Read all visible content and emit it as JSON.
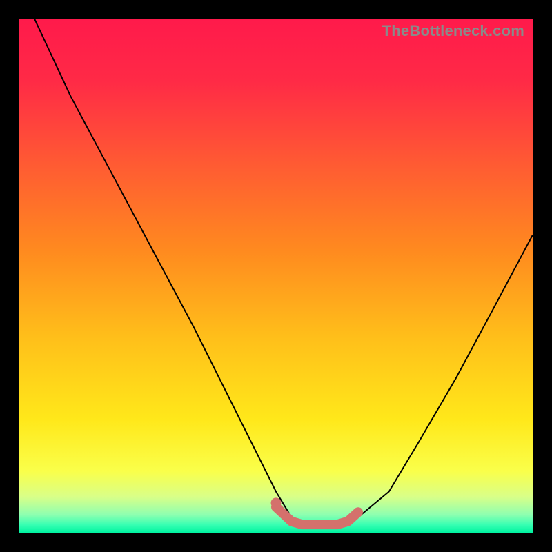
{
  "watermark": "TheBottleneck.com",
  "gradient_stops": [
    {
      "offset": 0.0,
      "color": "#ff1a4b"
    },
    {
      "offset": 0.12,
      "color": "#ff2a46"
    },
    {
      "offset": 0.28,
      "color": "#ff5a33"
    },
    {
      "offset": 0.45,
      "color": "#ff8a1f"
    },
    {
      "offset": 0.62,
      "color": "#ffbf1a"
    },
    {
      "offset": 0.78,
      "color": "#ffe81a"
    },
    {
      "offset": 0.88,
      "color": "#faff4a"
    },
    {
      "offset": 0.93,
      "color": "#d9ff88"
    },
    {
      "offset": 0.965,
      "color": "#8effb0"
    },
    {
      "offset": 0.985,
      "color": "#36ffb2"
    },
    {
      "offset": 1.0,
      "color": "#00f3a0"
    }
  ],
  "chart_data": {
    "type": "line",
    "title": "",
    "xlabel": "",
    "ylabel": "",
    "xlim": [
      0,
      100
    ],
    "ylim": [
      0,
      100
    ],
    "grid": false,
    "legend": false,
    "series": [
      {
        "name": "bottleneck-curve",
        "color": "#000000",
        "stroke_width": 2,
        "x": [
          3,
          10,
          18,
          26,
          34,
          40,
          46,
          50,
          53,
          55,
          58,
          62,
          66,
          72,
          78,
          85,
          92,
          100
        ],
        "values": [
          100,
          85,
          70,
          55,
          40,
          28,
          16,
          8,
          3,
          1,
          1,
          1,
          3,
          8,
          18,
          30,
          43,
          58
        ]
      },
      {
        "name": "optimal-zone",
        "color": "#d4716c",
        "stroke_width": 14,
        "linecap": "round",
        "x": [
          50,
          53,
          55,
          58,
          62,
          64,
          66
        ],
        "values": [
          5,
          2.2,
          1.6,
          1.6,
          1.6,
          2.2,
          4
        ]
      }
    ],
    "markers": [
      {
        "name": "optimal-start-dot",
        "x": 50,
        "y": 5.8,
        "r": 7,
        "color": "#d4716c"
      }
    ]
  }
}
